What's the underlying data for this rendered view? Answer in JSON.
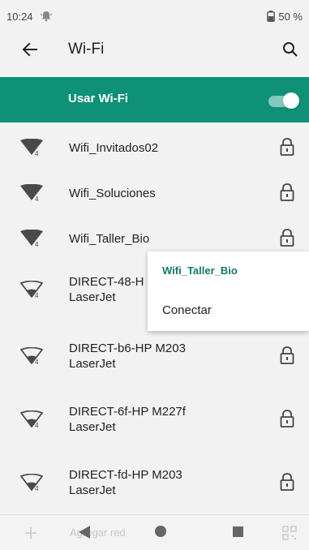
{
  "status_bar": {
    "time": "10:24",
    "battery": "50 %"
  },
  "app_bar": {
    "title": "Wi-Fi"
  },
  "wifi_toggle": {
    "label": "Usar Wi-Fi",
    "enabled": true,
    "color": "#0f9178"
  },
  "networks": [
    {
      "name": "Wifi_Invitados02",
      "line2": "",
      "secured": true,
      "signal_icon": "wifi-signal-strong-icon"
    },
    {
      "name": "Wifi_Soluciones",
      "line2": "",
      "secured": true,
      "signal_icon": "wifi-signal-strong-icon"
    },
    {
      "name": "Wifi_Taller_Bio",
      "line2": "",
      "secured": true,
      "signal_icon": "wifi-signal-strong-icon"
    },
    {
      "name": "DIRECT-48-H",
      "line2": "LaserJet",
      "secured": true,
      "signal_icon": "wifi-signal-weak-icon"
    },
    {
      "name": "DIRECT-b6-HP M203",
      "line2": "LaserJet",
      "secured": true,
      "signal_icon": "wifi-signal-weak-icon"
    },
    {
      "name": "DIRECT-6f-HP M227f",
      "line2": "LaserJet",
      "secured": true,
      "signal_icon": "wifi-signal-weak-icon"
    },
    {
      "name": "DIRECT-fd-HP M203",
      "line2": "LaserJet",
      "secured": true,
      "signal_icon": "wifi-signal-weak-icon"
    }
  ],
  "context_menu": {
    "title": "Wifi_Taller_Bio",
    "items": [
      "Conectar"
    ]
  },
  "bottom_bar": {
    "add_network": "Agregar red"
  }
}
